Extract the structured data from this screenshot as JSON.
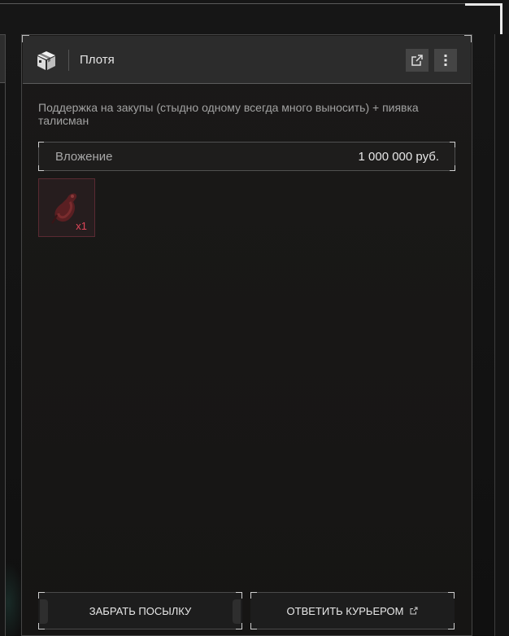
{
  "card": {
    "title": "Плотя",
    "message": "Поддержка на закупы (стыдно одному всегда много выносить) + пиявка талисман",
    "investment": {
      "label": "Вложение",
      "value": "1 000 000 руб."
    },
    "items": [
      {
        "icon": "leech-talisman-icon",
        "count": "x1"
      }
    ],
    "buttons": {
      "take": "ЗАБРАТЬ ПОСЫЛКУ",
      "reply": "ОТВЕТИТЬ КУРЬЕРОМ"
    }
  },
  "colors": {
    "accent_count": "#e0465a",
    "header_bg": "#2c2c2c",
    "panel_bg": "#1a1918"
  }
}
